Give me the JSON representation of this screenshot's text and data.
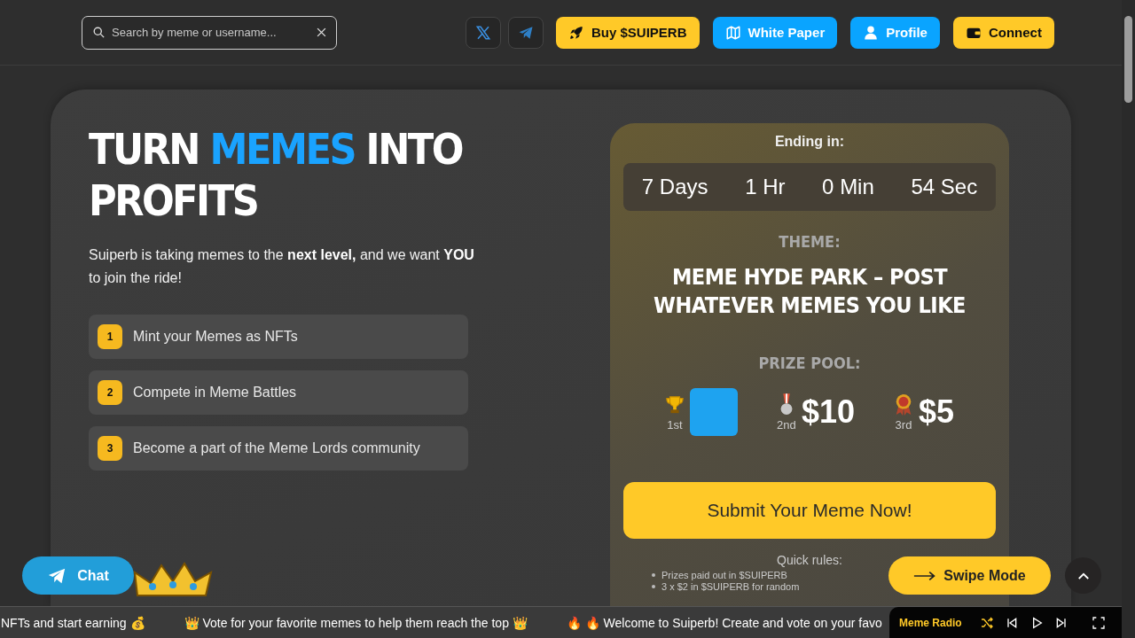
{
  "header": {
    "search": {
      "placeholder": "Search by meme or username..."
    },
    "socials": [
      {
        "kind": "x"
      },
      {
        "kind": "telegram"
      }
    ],
    "buttons": [
      {
        "label": "Buy $SUIPERB",
        "kind": "yellow"
      },
      {
        "label": "White Paper",
        "kind": "blue"
      },
      {
        "label": "Profile",
        "kind": "blue"
      },
      {
        "label": "Connect",
        "kind": "yellow"
      }
    ]
  },
  "hero": {
    "title": [
      {
        "text": "TURN ",
        "highlight": false
      },
      {
        "text": "MEMES",
        "highlight": true
      },
      {
        "text": " INTO PROFITS",
        "highlight": false
      }
    ],
    "intro": "Suiperb is taking memes to the **next level,** and we want **YOU** to join the ride!",
    "steps": [
      {
        "number": "1",
        "text": "Mint your Memes as NFTs"
      },
      {
        "number": "2",
        "text": "Compete in Meme Battles"
      },
      {
        "number": "3",
        "text": "Become a part of the Meme Lords community"
      }
    ]
  },
  "contest": {
    "ending_label": "Ending in:",
    "countdown": [
      "7 Days",
      "1 Hr",
      "0 Min",
      "54 Sec"
    ],
    "theme_label": "THEME:",
    "theme": "MEME HYDE PARK – POST WHATEVER MEMES YOU LIKE",
    "prize_label": "PRIZE POOL:",
    "prizes": [
      {
        "place": "1st",
        "kind": "photo"
      },
      {
        "place": "2nd",
        "kind": "amount",
        "amount": "$10"
      },
      {
        "place": "3rd",
        "kind": "amount",
        "amount": "$5"
      }
    ],
    "submit": "Submit Your Meme Now!",
    "rules_label": "Quick rules:",
    "rules": [
      "Prizes paid out in $SUIPERB",
      "3 x $2 in $SUIPERB for random"
    ]
  },
  "chat_button": "Chat",
  "swipe_button": "Swipe Mode",
  "ticker": [
    "NFTs and start earning 💰",
    "👑 Vote for your favorite memes to help them reach the top 👑",
    "🔥 🔥 Welcome to Suiperb! Create and vote on your favo"
  ],
  "radio": {
    "title": "Meme Radio"
  }
}
